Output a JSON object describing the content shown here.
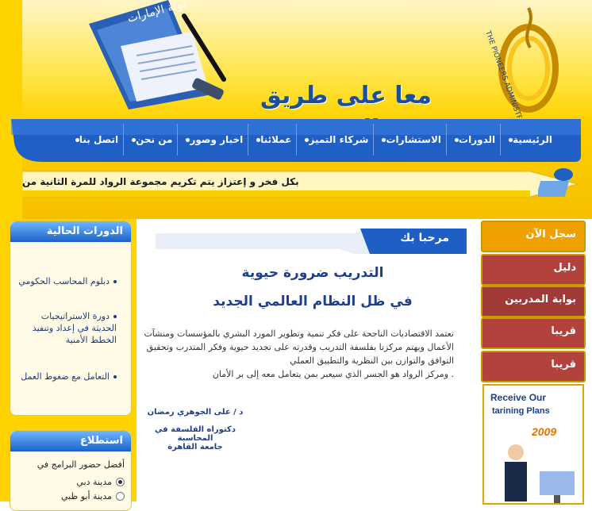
{
  "header": {
    "slogan": "معا على طريق التميز",
    "paper_title": "دولة الإمارات",
    "logo_text": "THE PIONEERS ADMINISTRATIVE TRAINING"
  },
  "nav": {
    "items": [
      "الرئيسية",
      "الدورات",
      "الاستشارات",
      "شركاء التميز",
      "عملائنا",
      "اخبار وصور",
      "من نحن",
      "اتصل بنا"
    ]
  },
  "ticker": {
    "text": "بكل فخر و إعتزاز يتم تكريم مجموعة الرواد للمرة الثانية من"
  },
  "left": {
    "courses_title": "الدورات الحالية",
    "courses": [
      "دبلوم المحاسب الحكومي",
      "دورة الاستراتيجيات الحديثة في إعداد وتنفيذ الخطط الأمنية",
      "التعامل مع ضغوط العمل"
    ],
    "poll_title": "استطلاع",
    "poll_question": "أفضل حضور البرامج في",
    "poll_options": [
      {
        "label": "مدينة دبي",
        "selected": true
      },
      {
        "label": "مدينة أبو ظبي",
        "selected": false
      }
    ]
  },
  "center": {
    "welcome": "مرحبا بك",
    "heading_line1": "التدريب ضرورة حيوية",
    "heading_line2": "في ظل النظام العالمي الجديد",
    "paragraph1": "تعتمد الاقتصاديات الناجحة على فكر تنمية وتطوير المورد البشري بالمؤسسات ومنشآت الأعمال ويهتم مركزنا بفلسفة التدريب وقدرته على تجديد حيوية وفكر المتدرب وتحقيق التوافق والتوازن بين النظرية والتطبيق العملي",
    "paragraph2": ". ومركز الرواد هو الجسر الذي سيعبر بمن يتعامل معه إلى بر الأمان",
    "signature": [
      "د / على الجوهري رمضان",
      "دكتوراه الفلسفة في المحاسبة",
      "جامعة القاهرة"
    ]
  },
  "right": {
    "buttons": [
      {
        "label": "سجل الآن",
        "color": "#f0a000"
      },
      {
        "label": "دليل",
        "color": "#b4423c"
      },
      {
        "label": "بوابة المدربين",
        "color": "#a13a36"
      },
      {
        "label": "قريبا",
        "color": "#b4423c"
      },
      {
        "label": "قريبا",
        "color": "#b4423c"
      }
    ],
    "ad_line1": "Receive Our",
    "ad_line2": "tarining Plans",
    "ad_year": "2009"
  },
  "colors": {
    "nav_blue": "#1d5fc4",
    "gold": "#ffd300",
    "heading_blue": "#1d3f8c"
  }
}
